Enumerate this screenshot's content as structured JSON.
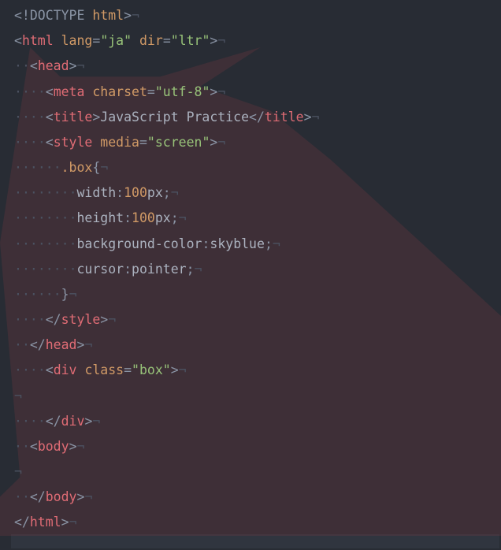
{
  "invisibles": {
    "pilcrow": "¬",
    "dot": "·",
    "bar": "|"
  },
  "lines": [
    {
      "indent": 0,
      "kind": "doctype",
      "frags": [
        {
          "c": "punct",
          "t": "<!"
        },
        {
          "c": "doctype",
          "t": "DOCTYPE"
        },
        {
          "c": "txt",
          "t": " "
        },
        {
          "c": "attr",
          "t": "html"
        },
        {
          "c": "punct",
          "t": ">"
        }
      ]
    },
    {
      "indent": 0,
      "kind": "tagopen",
      "frags": [
        {
          "c": "punct",
          "t": "<"
        },
        {
          "c": "tagname",
          "t": "html"
        },
        {
          "c": "txt",
          "t": " "
        },
        {
          "c": "attr",
          "t": "lang"
        },
        {
          "c": "punct",
          "t": "="
        },
        {
          "c": "val",
          "t": "\"ja\""
        },
        {
          "c": "txt",
          "t": " "
        },
        {
          "c": "attr",
          "t": "dir"
        },
        {
          "c": "punct",
          "t": "="
        },
        {
          "c": "val",
          "t": "\"ltr\""
        },
        {
          "c": "punct",
          "t": ">"
        }
      ]
    },
    {
      "indent": 1,
      "kind": "tagopen",
      "frags": [
        {
          "c": "punct",
          "t": "<"
        },
        {
          "c": "tagname",
          "t": "head"
        },
        {
          "c": "punct",
          "t": ">"
        }
      ]
    },
    {
      "indent": 2,
      "kind": "tagself",
      "frags": [
        {
          "c": "punct",
          "t": "<"
        },
        {
          "c": "tagname",
          "t": "meta"
        },
        {
          "c": "txt",
          "t": " "
        },
        {
          "c": "attr",
          "t": "charset"
        },
        {
          "c": "punct",
          "t": "="
        },
        {
          "c": "val",
          "t": "\"utf-8\""
        },
        {
          "c": "punct",
          "t": ">"
        }
      ]
    },
    {
      "indent": 2,
      "kind": "inline",
      "frags": [
        {
          "c": "punct",
          "t": "<"
        },
        {
          "c": "tagname",
          "t": "title"
        },
        {
          "c": "punct",
          "t": ">"
        },
        {
          "c": "txt",
          "t": "JavaScript Practice"
        },
        {
          "c": "punct",
          "t": "</"
        },
        {
          "c": "tagname",
          "t": "title"
        },
        {
          "c": "punct",
          "t": ">"
        }
      ]
    },
    {
      "indent": 2,
      "kind": "tagopen",
      "frags": [
        {
          "c": "punct",
          "t": "<"
        },
        {
          "c": "tagname",
          "t": "style"
        },
        {
          "c": "txt",
          "t": " "
        },
        {
          "c": "attr",
          "t": "media"
        },
        {
          "c": "punct",
          "t": "="
        },
        {
          "c": "val",
          "t": "\"screen\""
        },
        {
          "c": "punct",
          "t": ">"
        }
      ]
    },
    {
      "indent": 3,
      "kind": "css",
      "frags": [
        {
          "c": "cssclass",
          "t": ".box"
        },
        {
          "c": "punct",
          "t": "{"
        }
      ]
    },
    {
      "indent": 4,
      "kind": "css",
      "frags": [
        {
          "c": "prop",
          "t": "width"
        },
        {
          "c": "punct",
          "t": ":"
        },
        {
          "c": "num",
          "t": "100"
        },
        {
          "c": "kw",
          "t": "px"
        },
        {
          "c": "punct",
          "t": ";"
        }
      ]
    },
    {
      "indent": 4,
      "kind": "css",
      "frags": [
        {
          "c": "prop",
          "t": "height"
        },
        {
          "c": "punct",
          "t": ":"
        },
        {
          "c": "num",
          "t": "100"
        },
        {
          "c": "kw",
          "t": "px"
        },
        {
          "c": "punct",
          "t": ";"
        }
      ]
    },
    {
      "indent": 4,
      "kind": "css",
      "frags": [
        {
          "c": "prop",
          "t": "background-color"
        },
        {
          "c": "punct",
          "t": ":"
        },
        {
          "c": "kw",
          "t": "skyblue"
        },
        {
          "c": "punct",
          "t": ";"
        }
      ]
    },
    {
      "indent": 4,
      "kind": "css",
      "frags": [
        {
          "c": "prop",
          "t": "cursor"
        },
        {
          "c": "punct",
          "t": ":"
        },
        {
          "c": "kw",
          "t": "pointer"
        },
        {
          "c": "punct",
          "t": ";"
        }
      ]
    },
    {
      "indent": 3,
      "kind": "css",
      "frags": [
        {
          "c": "punct",
          "t": "}"
        }
      ]
    },
    {
      "indent": 2,
      "kind": "tagclose",
      "frags": [
        {
          "c": "punct",
          "t": "</"
        },
        {
          "c": "tagname",
          "t": "style"
        },
        {
          "c": "punct",
          "t": ">"
        }
      ]
    },
    {
      "indent": 1,
      "kind": "tagclose",
      "frags": [
        {
          "c": "punct",
          "t": "</"
        },
        {
          "c": "tagname",
          "t": "head"
        },
        {
          "c": "punct",
          "t": ">"
        }
      ]
    },
    {
      "indent": 2,
      "kind": "tagopen",
      "frags": [
        {
          "c": "punct",
          "t": "<"
        },
        {
          "c": "tagname",
          "t": "div"
        },
        {
          "c": "txt",
          "t": " "
        },
        {
          "c": "attr",
          "t": "class"
        },
        {
          "c": "punct",
          "t": "="
        },
        {
          "c": "val",
          "t": "\"box\""
        },
        {
          "c": "punct",
          "t": ">"
        }
      ]
    },
    {
      "indent": 0,
      "kind": "blank",
      "frags": []
    },
    {
      "indent": 2,
      "kind": "tagclose",
      "frags": [
        {
          "c": "punct",
          "t": "</"
        },
        {
          "c": "tagname",
          "t": "div"
        },
        {
          "c": "punct",
          "t": ">"
        }
      ]
    },
    {
      "indent": 1,
      "kind": "tagopen",
      "frags": [
        {
          "c": "punct",
          "t": "<"
        },
        {
          "c": "tagname",
          "t": "body"
        },
        {
          "c": "punct",
          "t": ">"
        }
      ]
    },
    {
      "indent": 0,
      "kind": "blank",
      "frags": []
    },
    {
      "indent": 1,
      "kind": "tagclose",
      "frags": [
        {
          "c": "punct",
          "t": "</"
        },
        {
          "c": "tagname",
          "t": "body"
        },
        {
          "c": "punct",
          "t": ">"
        }
      ]
    },
    {
      "indent": 0,
      "kind": "tagclose",
      "frags": [
        {
          "c": "punct",
          "t": "</"
        },
        {
          "c": "tagname",
          "t": "html"
        },
        {
          "c": "punct",
          "t": ">"
        }
      ]
    }
  ]
}
